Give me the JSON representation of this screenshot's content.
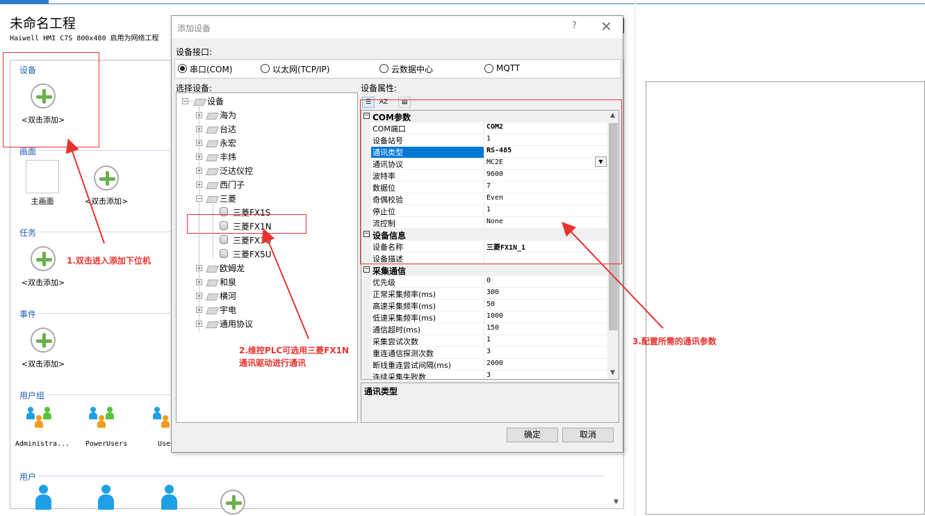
{
  "app": {
    "project_title": "未命名工程",
    "project_subtitle": "Haiwell HMI C7S  800x480  启用为网络工程"
  },
  "canvas": {
    "sections": {
      "devices": {
        "label": "设备",
        "items": [
          {
            "label": "<双击添加>"
          }
        ]
      },
      "screens": {
        "label": "画面",
        "items": [
          {
            "label": "主画面"
          },
          {
            "label": "<双击添加>"
          }
        ]
      },
      "tasks": {
        "label": "任务",
        "items": [
          {
            "label": "<双击添加>"
          }
        ]
      },
      "events": {
        "label": "事件",
        "items": [
          {
            "label": "<双击添加>"
          }
        ]
      },
      "user_groups": {
        "label": "用户组",
        "items": [
          {
            "label": "Administra..."
          },
          {
            "label": "PowerUsers"
          },
          {
            "label": "Use"
          }
        ]
      },
      "users": {
        "label": "用户"
      }
    }
  },
  "dialog": {
    "title": "添加设备",
    "help": "?",
    "close": "✕",
    "interface_label": "设备接口:",
    "interfaces": [
      {
        "label": "串口(COM)",
        "selected": true
      },
      {
        "label": "以太网(TCP/IP)",
        "selected": false
      },
      {
        "label": "云数据中心",
        "selected": false
      },
      {
        "label": "MQTT",
        "selected": false
      }
    ],
    "select_device_label": "选择设备:",
    "tree": {
      "root": "设备",
      "vendors": [
        "海为",
        "台达",
        "永宏",
        "丰炜",
        "泛达仪控",
        "西门子",
        "三菱",
        "欧姆龙",
        "和泉",
        "横河",
        "宇电",
        "通用协议"
      ],
      "mitsubishi_children": [
        "三菱FX1S",
        "三菱FX1N",
        "三菱FX3U",
        "三菱FX5U"
      ]
    },
    "props_label": "设备属性:",
    "props": [
      {
        "type": "cat",
        "k": "COM参数"
      },
      {
        "k": "COM端口",
        "v": "COM2",
        "bold": true
      },
      {
        "k": "设备站号",
        "v": "1"
      },
      {
        "k": "通讯类型",
        "v": "RS-485",
        "bold": true,
        "selected": true
      },
      {
        "k": "通讯协议",
        "v": "MC2E"
      },
      {
        "k": "波特率",
        "v": "9600"
      },
      {
        "k": "数据位",
        "v": "7"
      },
      {
        "k": "奇偶校验",
        "v": "Even"
      },
      {
        "k": "停止位",
        "v": "1"
      },
      {
        "k": "流控制",
        "v": "None"
      },
      {
        "type": "cat",
        "k": "设备信息"
      },
      {
        "k": "设备名称",
        "v": "三菱FX1N_1",
        "bold": true
      },
      {
        "k": "设备描述",
        "v": ""
      },
      {
        "type": "cat",
        "k": "采集通信"
      },
      {
        "k": "优先级",
        "v": "0"
      },
      {
        "k": "正常采集频率(ms)",
        "v": "300"
      },
      {
        "k": "高速采集频率(ms)",
        "v": "50"
      },
      {
        "k": "低速采集频率(ms)",
        "v": "1000"
      },
      {
        "k": "通信超时(ms)",
        "v": "150"
      },
      {
        "k": "采集尝试次数",
        "v": "1"
      },
      {
        "k": "重连通信探测次数",
        "v": "3"
      },
      {
        "k": "断线重连尝试间隔(ms)",
        "v": "2000"
      },
      {
        "k": "连续采集失败数",
        "v": "3"
      }
    ],
    "description_title": "通讯类型",
    "ok": "确定",
    "cancel": "取消"
  },
  "annotations": {
    "a1": "1.双击进入添加下位机",
    "a2_line1": "2.维控PLC可选用三菱FX1N",
    "a2_line2": "通讯驱动进行通讯",
    "a3": "3.配置所需的通讯参数"
  },
  "colors": {
    "annotation": "#e8322e",
    "selection": "#0078d7",
    "accent": "#2b79d0"
  }
}
